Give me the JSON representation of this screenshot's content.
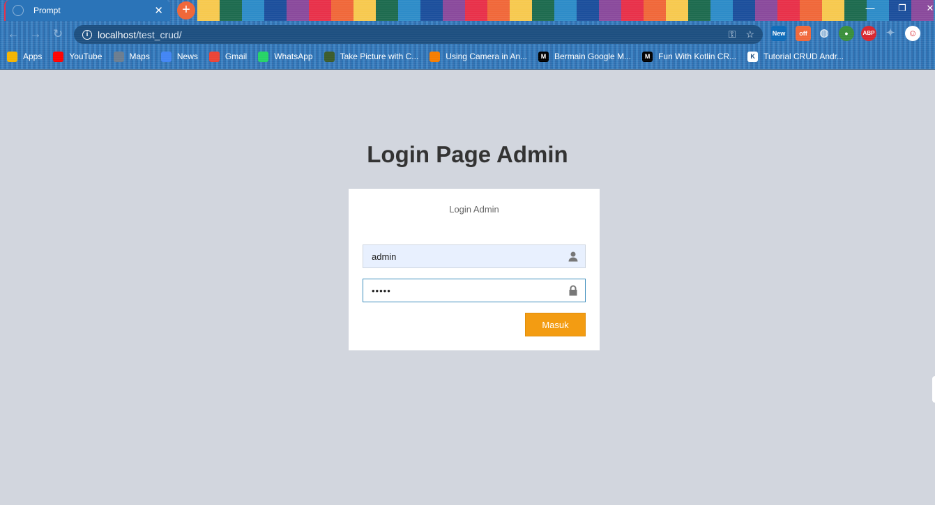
{
  "browser": {
    "tab_title": "Prompt",
    "url_host": "localhost",
    "url_path": "/test_crud/",
    "theme_stripes": [
      "#f7c94f",
      "#1e6b4f",
      "#2e8cc8",
      "#1c4f9c",
      "#8a4a9c",
      "#e8314a",
      "#f0683a",
      "#f7c94f",
      "#1e6b4f",
      "#2e8cc8",
      "#1c4f9c",
      "#8a4a9c",
      "#e8314a",
      "#f0683a",
      "#f7c94f",
      "#1e6b4f",
      "#2e8cc8",
      "#1c4f9c",
      "#8a4a9c",
      "#e8314a",
      "#f0683a",
      "#f7c94f",
      "#1e6b4f",
      "#2e8cc8",
      "#1c4f9c",
      "#8a4a9c",
      "#e8314a",
      "#f0683a",
      "#f7c94f",
      "#1e6b4f",
      "#2e8cc8",
      "#1c4f9c",
      "#8a4a9c"
    ],
    "extensions": {
      "new_label": "New",
      "off_label": "off",
      "abp_label": "ABP"
    },
    "bookmarks": [
      {
        "label": "Apps",
        "icon": "apps-grid-icon",
        "color": "#f4b400"
      },
      {
        "label": "YouTube",
        "icon": "youtube-icon",
        "color": "#ff0000"
      },
      {
        "label": "Maps",
        "icon": "maps-icon",
        "color": "#6b7d8f"
      },
      {
        "label": "News",
        "icon": "google-news-icon",
        "color": "#4285f4"
      },
      {
        "label": "Gmail",
        "icon": "gmail-icon",
        "color": "#ea4335"
      },
      {
        "label": "WhatsApp",
        "icon": "whatsapp-icon",
        "color": "#25d366"
      },
      {
        "label": "Take Picture with C...",
        "icon": "android-icon",
        "color": "#3b5b2a"
      },
      {
        "label": "Using Camera in An...",
        "icon": "blogger-icon",
        "color": "#f57d00"
      },
      {
        "label": "Bermain Google M...",
        "icon": "medium-icon",
        "color": "#000000"
      },
      {
        "label": "Fun With Kotlin CR...",
        "icon": "medium-icon",
        "color": "#000000"
      },
      {
        "label": "Tutorial CRUD Andr...",
        "icon": "kotlin-icon",
        "color": "#ffffff"
      }
    ]
  },
  "page": {
    "title": "Login Page Admin",
    "box_title": "Login Admin",
    "username_value": "admin",
    "password_value": "•••••",
    "submit_label": "Masuk",
    "accent_color": "#f39c12",
    "background_color": "#d2d6de"
  }
}
